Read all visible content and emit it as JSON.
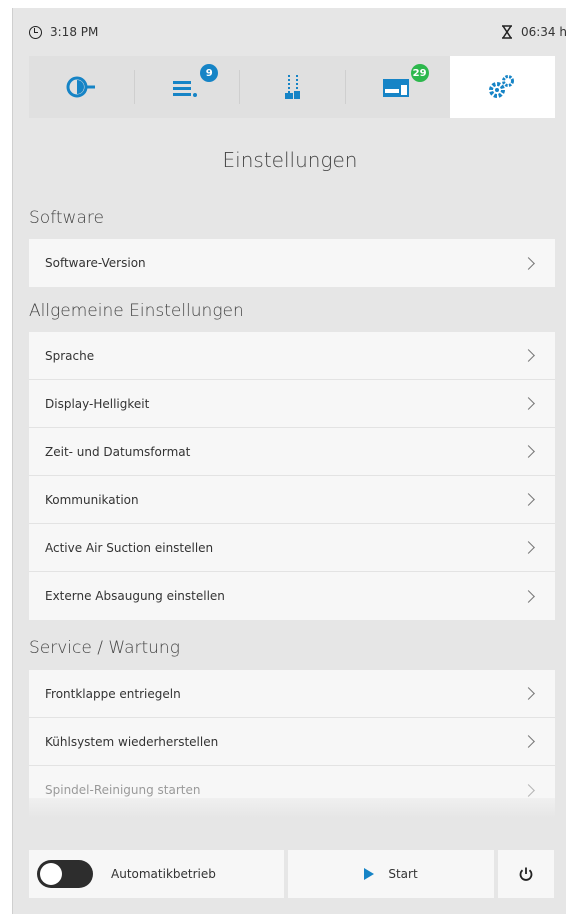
{
  "status": {
    "time": "3:18 PM",
    "runtime": "06:34 h"
  },
  "tabs": [
    {
      "icon": "spindle-icon"
    },
    {
      "icon": "job-list-icon",
      "badge": "9"
    },
    {
      "icon": "tools-icon"
    },
    {
      "icon": "storage-icon",
      "badge": "29"
    },
    {
      "icon": "settings-gears-icon",
      "active": true
    }
  ],
  "title": "Einstellungen",
  "sections": {
    "software": {
      "title": "Software",
      "items": [
        "Software-Version"
      ]
    },
    "general": {
      "title": "Allgemeine Einstellungen",
      "items": [
        "Sprache",
        "Display-Helligkeit",
        "Zeit- und Datumsformat",
        "Kommunikation",
        "Active Air Suction einstellen",
        "Externe Absaugung einstellen"
      ]
    },
    "service": {
      "title": "Service / Wartung",
      "items": [
        "Frontklappe entriegeln",
        "Kühlsystem wiederherstellen",
        "Spindel-Reinigung starten"
      ]
    }
  },
  "bottom": {
    "auto_label": "Automatikbetrieb",
    "start_label": "Start"
  },
  "colors": {
    "accent": "#1684c6",
    "badge_green": "#2db84d"
  }
}
